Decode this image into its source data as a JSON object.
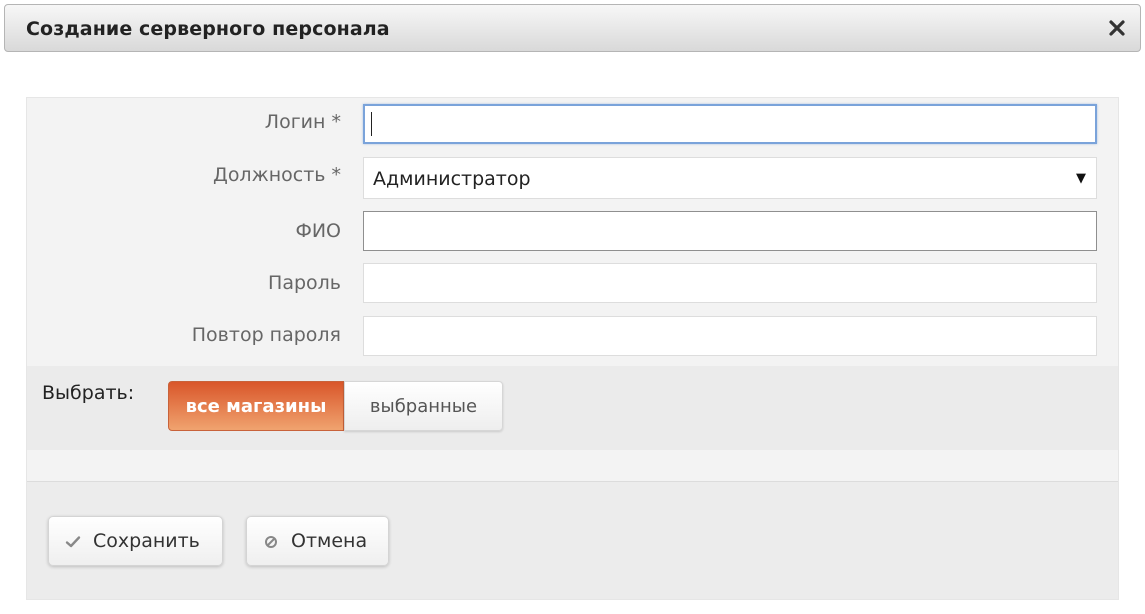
{
  "dialog": {
    "title": "Создание серверного персонала",
    "close_icon": "close-icon"
  },
  "form": {
    "login": {
      "label": "Логин *",
      "value": ""
    },
    "position": {
      "label": "Должность *",
      "selected": "Администратор"
    },
    "full_name": {
      "label": "ФИО",
      "value": ""
    },
    "password": {
      "label": "Пароль",
      "value": ""
    },
    "password_repeat": {
      "label": "Повтор пароля",
      "value": ""
    }
  },
  "store_selector": {
    "label": "Выбрать:",
    "options": [
      {
        "label": "все магазины",
        "active": true
      },
      {
        "label": "выбранные",
        "active": false
      }
    ]
  },
  "actions": {
    "save_label": "Сохранить",
    "cancel_label": "Отмена"
  },
  "colors": {
    "accent": "#e06a35",
    "focus": "#7aa3da"
  }
}
